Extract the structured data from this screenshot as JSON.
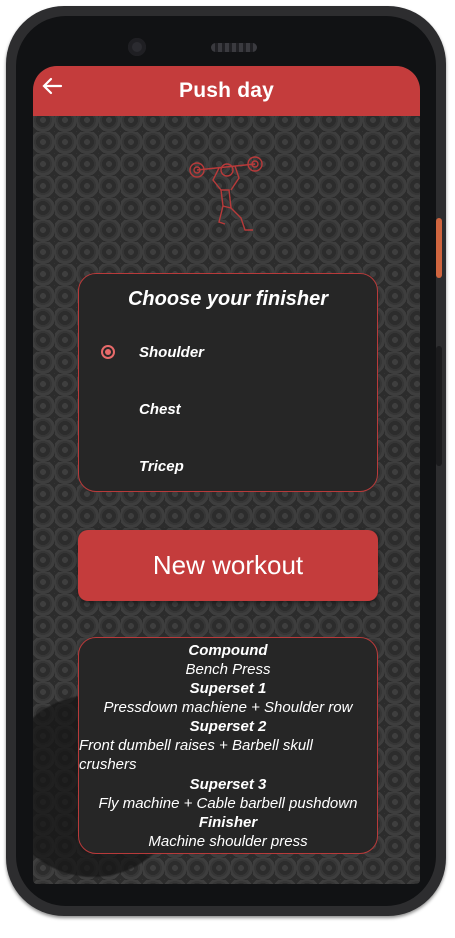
{
  "app_bar": {
    "back_icon": "arrow-left-icon",
    "title": "Push day"
  },
  "finisher_card": {
    "title": "Choose your finisher",
    "options": [
      {
        "label": "Shoulder",
        "selected": true
      },
      {
        "label": "Chest",
        "selected": false
      },
      {
        "label": "Tricep",
        "selected": false
      }
    ]
  },
  "new_workout_button": "New workout",
  "workout": {
    "compound_heading": "Compound",
    "compound": "Bench Press",
    "superset1_heading": "Superset 1",
    "superset1": "Pressdown machiene + Shoulder row",
    "superset2_heading": "Superset 2",
    "superset2": "Front dumbell raises + Barbell skull crushers",
    "superset3_heading": "Superset 3",
    "superset3": "Fly machine + Cable barbell pushdown",
    "finisher_heading": "Finisher",
    "finisher": "Machine shoulder press"
  },
  "colors": {
    "accent": "#c43c3c",
    "card_background": "#262626",
    "radio": "#e86a6a"
  }
}
